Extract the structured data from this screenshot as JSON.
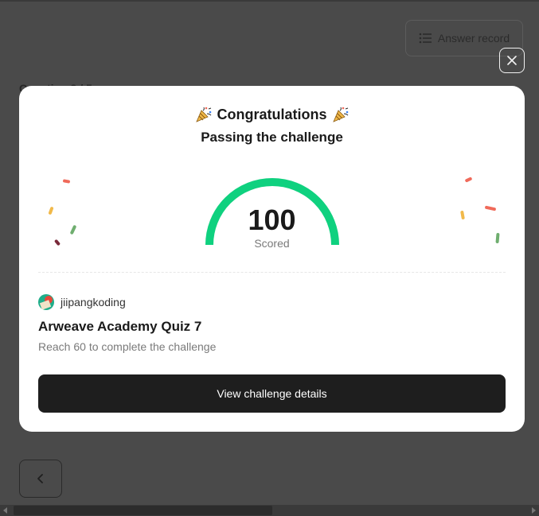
{
  "background": {
    "answer_record_label": "Answer record",
    "question_label": "Question 3 / 5"
  },
  "modal": {
    "title": "Congratulations",
    "subtitle": "Passing the challenge",
    "score": {
      "value": "100",
      "label": "Scored",
      "percent": 100
    },
    "creator": {
      "name": "jiipangkoding"
    },
    "quiz_title": "Arweave Academy Quiz 7",
    "quiz_description": "Reach 60 to complete the challenge",
    "view_button_label": "View challenge details"
  },
  "colors": {
    "gauge": "#0fd17f",
    "button_bg": "#1e1e1e",
    "confetti": [
      "#f06a5a",
      "#f1b94a",
      "#6fae6f",
      "#7a2a3a"
    ]
  },
  "icons": {
    "close": "close-icon",
    "back": "chevron-left-icon",
    "answer_record": "list-icon",
    "party": "party-popper-icon"
  }
}
